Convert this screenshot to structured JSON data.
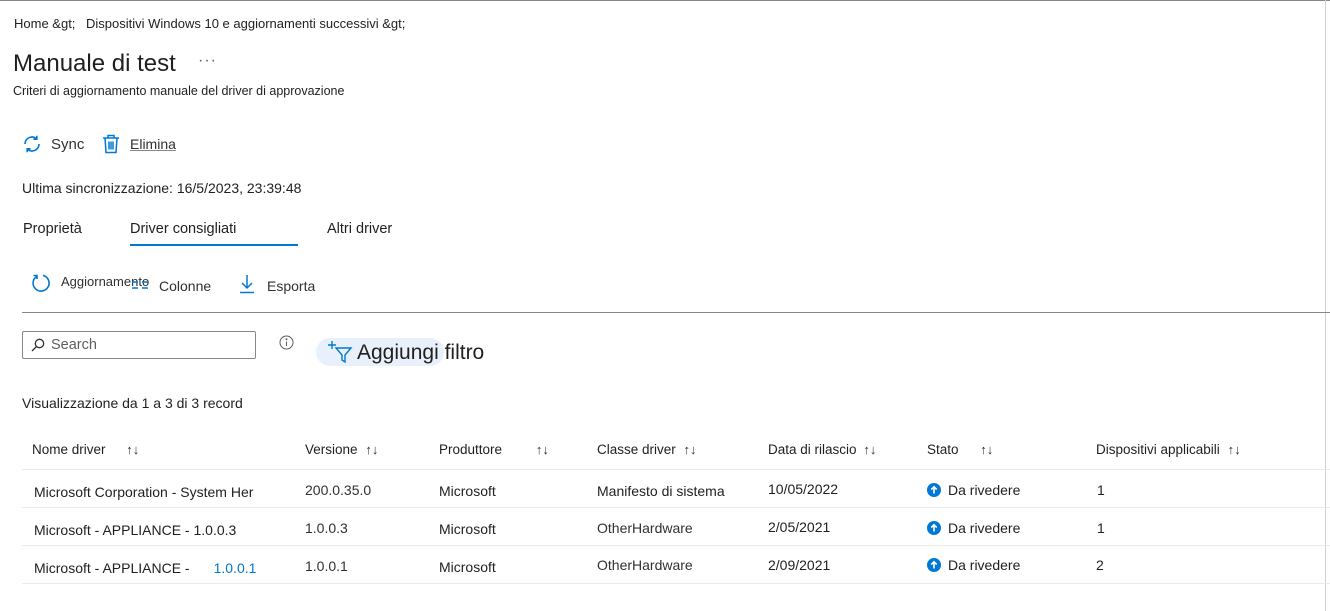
{
  "breadcrumb": {
    "home": "Home &gt;",
    "section": "Dispositivi Windows 10 e aggiornamenti successivi &gt;"
  },
  "page": {
    "title": "Manuale di test",
    "more": "···",
    "subtitle": "Criteri di aggiornamento manuale del driver di approvazione"
  },
  "commands": {
    "sync": "Sync",
    "delete": "Elimina"
  },
  "last_sync": "Ultima sincronizzazione: 16/5/2023, 23:39:48",
  "tabs": [
    {
      "label": "Proprietà"
    },
    {
      "label": "Driver consigliati",
      "selected": true
    },
    {
      "label": "Altri driver"
    }
  ],
  "toolbar": {
    "refresh": "Aggiornamento",
    "columns": "Colonne",
    "export": "Esporta"
  },
  "search": {
    "placeholder": "Search",
    "value": ""
  },
  "filter": {
    "add_filter": "Aggiungi filtro"
  },
  "records_text": "Visualizzazione da 1 a 3 di 3 record",
  "table": {
    "headers": [
      {
        "label": "Nome driver"
      },
      {
        "label": "Versione"
      },
      {
        "label": "Produttore"
      },
      {
        "label": "Classe driver"
      },
      {
        "label": "Data di rilascio"
      },
      {
        "label": "Stato"
      },
      {
        "label": "Dispositivi applicabili"
      }
    ],
    "sort_glyph": "↑↓",
    "rows": [
      {
        "name": "Microsoft Corporation - System Her",
        "name_link": "",
        "version": "200.0.35.0",
        "manufacturer": "Microsoft",
        "class": "Manifesto di sistema",
        "release_date": "10/05/2022",
        "status": "Da rivedere",
        "devices": "1"
      },
      {
        "name": "Microsoft - APPLIANCE - 1.0.0.3",
        "name_link": "",
        "version": "1.0.0.3",
        "manufacturer": "Microsoft",
        "class": "OtherHardware",
        "release_date": "2/05/2021",
        "status": "Da rivedere",
        "devices": "1"
      },
      {
        "name": "Microsoft - APPLIANCE -",
        "name_link": "1.0.0.1",
        "version": "1.0.0.1",
        "manufacturer": "Microsoft",
        "class": "OtherHardware",
        "release_date": "2/09/2021",
        "status": "Da rivedere",
        "devices": "2"
      }
    ]
  },
  "colors": {
    "accent": "#0078d4",
    "status_icon": "#0078d4",
    "filter_pill": "#e8f1fb"
  },
  "icons": {
    "sync": "sync-icon",
    "delete": "trash-icon",
    "refresh": "refresh-icon",
    "columns": "columns-icon",
    "export": "download-icon",
    "search": "search-icon",
    "info": "info-icon",
    "filter": "add-filter-icon",
    "status": "arrow-up-circle-icon"
  }
}
